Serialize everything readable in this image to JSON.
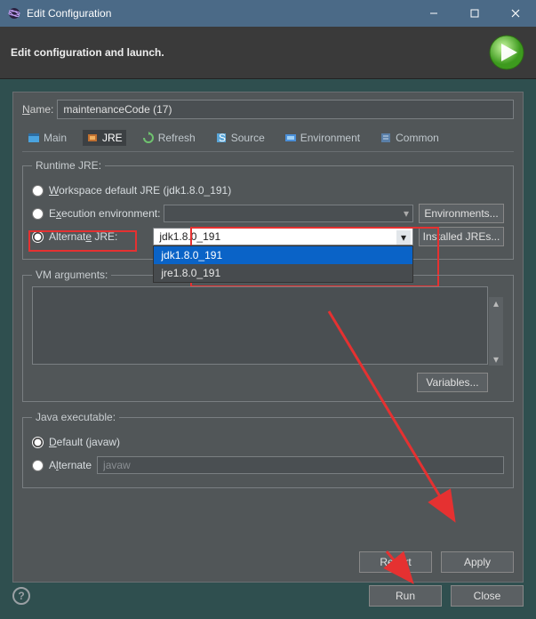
{
  "window": {
    "title": "Edit Configuration"
  },
  "header": {
    "heading": "Edit configuration and launch."
  },
  "name": {
    "label": "Name:",
    "value": "maintenanceCode (17)"
  },
  "tabs": {
    "main": "Main",
    "jre": "JRE",
    "refresh": "Refresh",
    "source": "Source",
    "environment": "Environment",
    "common": "Common"
  },
  "runtime": {
    "legend": "Runtime JRE:",
    "workspace_label": "Workspace default JRE (jdk1.8.0_191)",
    "exec_env_label": "Execution environment:",
    "alternate_label": "Alternate JRE:",
    "env_btn": "Environments...",
    "installed_btn": "Installed JREs...",
    "dropdown": {
      "selected": "jdk1.8.0_191",
      "options": [
        "jdk1.8.0_191",
        "jre1.8.0_191"
      ]
    }
  },
  "vm": {
    "legend": "VM arguments:",
    "value": "",
    "variables_btn": "Variables..."
  },
  "java_exec": {
    "legend": "Java executable:",
    "default_label": "Default (javaw)",
    "alternate_label": "Alternate",
    "alternate_value": "javaw"
  },
  "footer": {
    "revert": "Revert",
    "apply": "Apply"
  },
  "bottom": {
    "run": "Run",
    "close": "Close"
  }
}
